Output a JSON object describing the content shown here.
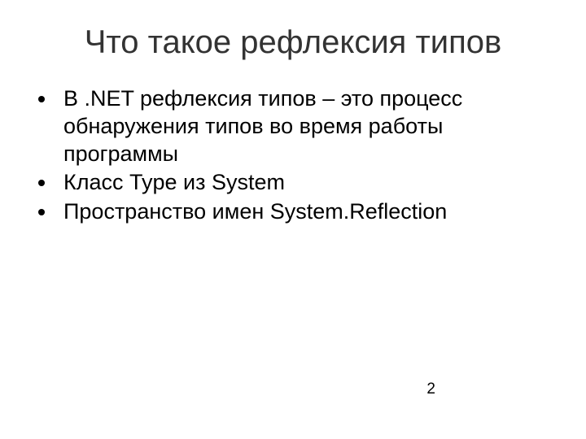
{
  "slide": {
    "title": "Что такое рефлексия типов",
    "bullets": [
      "В .NET рефлексия типов – это процесс обнаружения типов во время работы программы",
      "Класс Type из System",
      "Пространство имен System.Reflection"
    ],
    "page_number": "2"
  }
}
